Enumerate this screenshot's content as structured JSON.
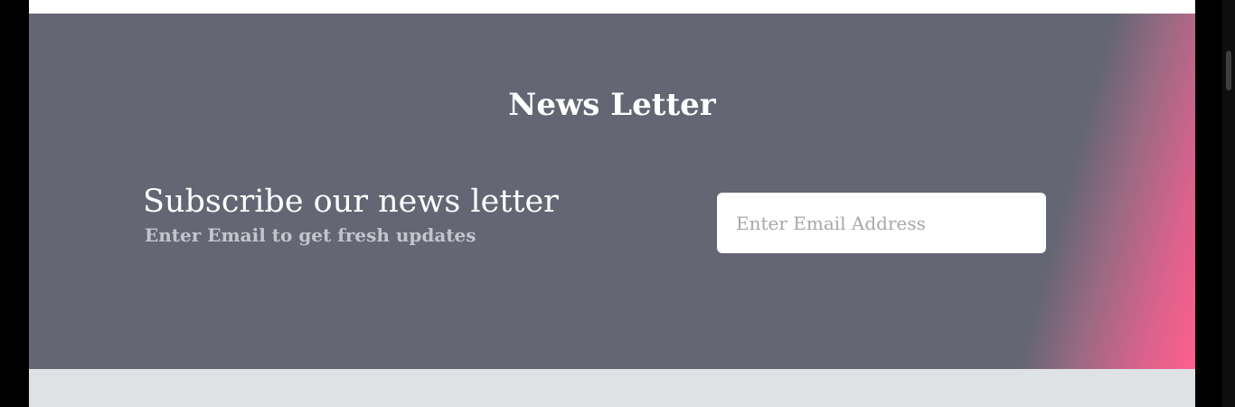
{
  "newsletter": {
    "title": "News Letter",
    "heading": "Subscribe our news letter",
    "subheading": "Enter Email to get fresh updates",
    "email_value": "",
    "email_placeholder": "Enter Email Address"
  },
  "colors": {
    "section_background": "#646674",
    "gradient_accent": "#ff5f8d",
    "footer_strip": "#dee2e4",
    "input_background": "#ffffff"
  }
}
